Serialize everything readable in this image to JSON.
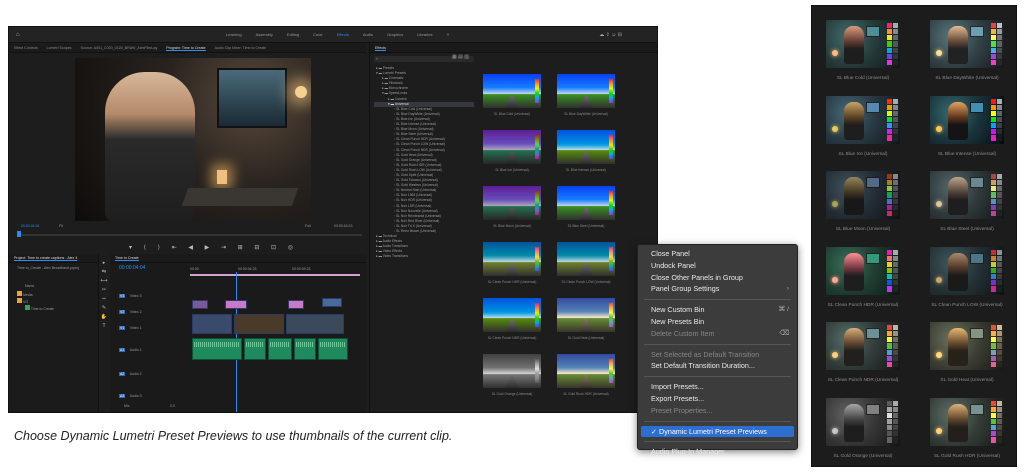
{
  "workspaces": [
    "Learning",
    "Assembly",
    "Editing",
    "Color",
    "Effects",
    "Audio",
    "Graphics",
    "Libraries"
  ],
  "active_workspace": "Effects",
  "source_tabs": [
    "Effect Controls",
    "Lumetri Scopes",
    "Source: A001_C020_011B_BRAW_AlexFilmLog",
    "Program: Time to Create",
    "Audio Clip Mixer: Time to Create"
  ],
  "program": {
    "timecode_in": "00:00:04:04",
    "fit": "Fit",
    "fraction": "Full",
    "timecode_out": "00:00:16:13"
  },
  "effects_panel": {
    "title": "Effects",
    "tree": [
      "Presets",
      "Lumetri Presets",
      "Cinematic",
      "Filmstock",
      "Monochrome",
      "SpeedLooks",
      "Camera",
      "Universal",
      "SL Blue Cold (Universal)",
      "SL Blue DayWhite (Universal)",
      "SL Blue Ice (Universal)",
      "SL Blue Intense (Universal)",
      "SL Blue Moon (Universal)",
      "SL Blue Steel (Universal)",
      "SL Clean Punch HDR (Universal)",
      "SL Clean Punch LOW (Universal)",
      "SL Clean Punch NDR (Universal)",
      "SL Gold Heat (Universal)",
      "SL Gold Orange (Universal)",
      "SL Gold Rush HDR (Universal)",
      "SL Gold Rush LOW (Universal)",
      "SL Gold Spirit (Universal)",
      "SL Gold Tobacco (Universal)",
      "SL Gold Western (Universal)",
      "SL Neutral Start (Universal)",
      "SL Noir 1965 (Universal)",
      "SL Noir HDR (Universal)",
      "SL Noir LDR (Universal)",
      "SL Noir Nouvelle (Universal)",
      "SL Noir Rembrandt (Universal)",
      "SL Noir Red River (Universal)",
      "SL Noir Tri-X (Universal)",
      "SL Retro Brown (Universal)",
      "Technical",
      "Audio Effects",
      "Audio Transitions",
      "Video Effects",
      "Video Transitions"
    ]
  },
  "thumbs": [
    "SL Blue Cold (Universal)",
    "SL Blue DayWhite (Universal)",
    "SL Blue Ice (Universal)",
    "SL Blue Intense (Universal)",
    "SL Blue Moon (Universal)",
    "SL Blue Steel (Universal)",
    "SL Clean Punch HDR (Universal)",
    "SL Clean Punch LOW (Universal)",
    "SL Clean Punch NDR (Universal)",
    "SL Gold Heat (Universal)",
    "SL Gold Orange (Universal)",
    "SL Gold Rush HDR (Universal)"
  ],
  "project": {
    "title": "Project: Time to create captions - Alex 4",
    "file": "Time to_Create - Alex Broadband.prproj",
    "name_col": "Name",
    "items": [
      "Media",
      "VO",
      "Time to Create"
    ]
  },
  "timeline": {
    "tab": "Time to Create",
    "timecode": "00:00:04:04",
    "ruler": [
      "00:00",
      "00:00:04:23",
      "00:00:09:23"
    ],
    "tracks": [
      "V3",
      "V2",
      "V1",
      "A1",
      "A2",
      "A3"
    ],
    "track_labels": [
      "Video 3",
      "Video 2",
      "Video 1",
      "Audio 1",
      "Audio 2",
      "Audio 3"
    ],
    "mix": "Mix",
    "mix_value": "0.0"
  },
  "menu": {
    "items": [
      {
        "label": "Close Panel",
        "disabled": false
      },
      {
        "label": "Undock Panel",
        "disabled": false
      },
      {
        "label": "Close Other Panels in Group",
        "disabled": false
      },
      {
        "label": "Panel Group Settings",
        "disabled": false,
        "arrow": "›"
      },
      {
        "sep": true
      },
      {
        "label": "New Custom Bin",
        "disabled": false,
        "shortcut": "⌘ /"
      },
      {
        "label": "New Presets Bin",
        "disabled": false
      },
      {
        "label": "Delete Custom Item",
        "disabled": true,
        "shortcut": "⌫"
      },
      {
        "sep": true
      },
      {
        "label": "Set Selected as Default Transition",
        "disabled": true
      },
      {
        "label": "Set Default Transition Duration...",
        "disabled": false
      },
      {
        "sep": true
      },
      {
        "label": "Import Presets...",
        "disabled": false
      },
      {
        "label": "Export Presets...",
        "disabled": false
      },
      {
        "label": "Preset Properties...",
        "disabled": true
      },
      {
        "sep": true
      },
      {
        "label": "Dynamic Lumetri Preset Previews",
        "disabled": false,
        "checked": true,
        "highlight": true
      },
      {
        "sep": true
      },
      {
        "label": "Audio Plug-In Manager...",
        "disabled": false
      }
    ]
  },
  "caption": "Choose Dynamic Lumetri Preset Previews to use thumbnails of the current clip.",
  "right_thumbs": [
    "SL Blue Cold (Universal)",
    "SL Blue DayWhite (Universal)",
    "SL Blue Ice (Universal)",
    "SL Blue Intense (Universal)",
    "SL Blue Moon (Universal)",
    "SL Blue Steel (Universal)",
    "SL Clean Punch HDR (Universal)",
    "SL Clean Punch LOW (Universal)",
    "SL Clean Punch NDR (Universal)",
    "SL Gold Heat (Universal)",
    "SL Gold Orange (Universal)",
    "SL Gold Rush HDR (Universal)"
  ],
  "colors": {
    "accent": "#2d8ceb",
    "menu_highlight": "#2c6fd1",
    "audio_clip": "#1f8a5e",
    "video_clip": "#5a6aa8"
  }
}
